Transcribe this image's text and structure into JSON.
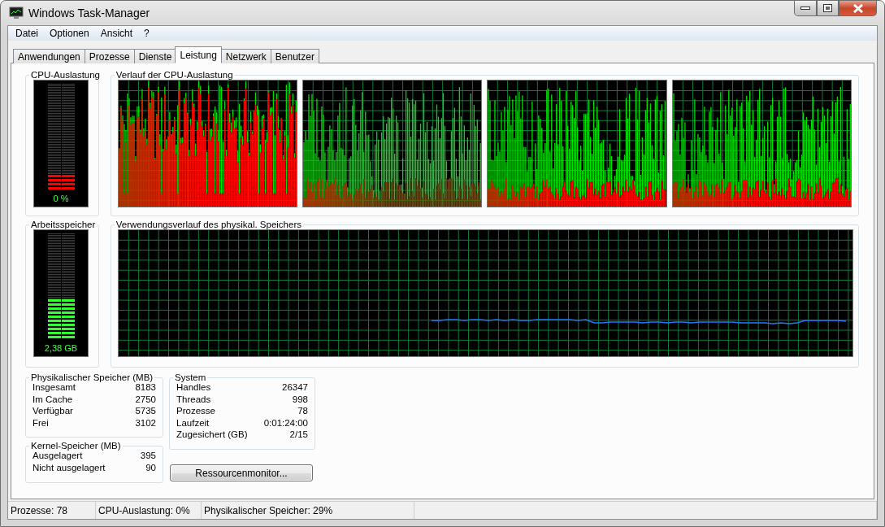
{
  "window": {
    "title": "Windows Task-Manager"
  },
  "menu": [
    "Datei",
    "Optionen",
    "Ansicht",
    "?"
  ],
  "tabs": [
    {
      "label": "Anwendungen",
      "selected": false
    },
    {
      "label": "Prozesse",
      "selected": false
    },
    {
      "label": "Dienste",
      "selected": false
    },
    {
      "label": "Leistung",
      "selected": true
    },
    {
      "label": "Netzwerk",
      "selected": false
    },
    {
      "label": "Benutzer",
      "selected": false
    }
  ],
  "cpu_usage": {
    "title": "CPU-Auslastung",
    "level": 0.14,
    "reading": "0 %"
  },
  "cpu_history": {
    "title": "Verlauf der CPU-Auslastung"
  },
  "memory": {
    "title": "Arbeitsspeicher",
    "level": 0.38,
    "reading": "2,38 GB"
  },
  "memory_history": {
    "title": "Verwendungsverlauf des physikal. Speichers"
  },
  "physical_memory": {
    "title": "Physikalischer Speicher (MB)",
    "rows": [
      {
        "label": "Insgesamt",
        "value": "8183"
      },
      {
        "label": "Im Cache",
        "value": "2750"
      },
      {
        "label": "Verfügbar",
        "value": "5735"
      },
      {
        "label": "Frei",
        "value": "3102"
      }
    ]
  },
  "kernel_memory": {
    "title": "Kernel-Speicher (MB)",
    "rows": [
      {
        "label": "Ausgelagert",
        "value": "395"
      },
      {
        "label": "Nicht ausgelagert",
        "value": "90"
      }
    ]
  },
  "system": {
    "title": "System",
    "rows": [
      {
        "label": "Handles",
        "value": "26347"
      },
      {
        "label": "Threads",
        "value": "998"
      },
      {
        "label": "Prozesse",
        "value": "78"
      },
      {
        "label": "Laufzeit",
        "value": "0:01:24:00"
      },
      {
        "label": "Zugesichert (GB)",
        "value": "2/15"
      }
    ]
  },
  "button": "Ressourcenmonitor...",
  "status_bar": [
    "Prozesse: 78",
    "CPU-Auslastung: 0%",
    "Physikalischer Speicher: 29%"
  ]
}
